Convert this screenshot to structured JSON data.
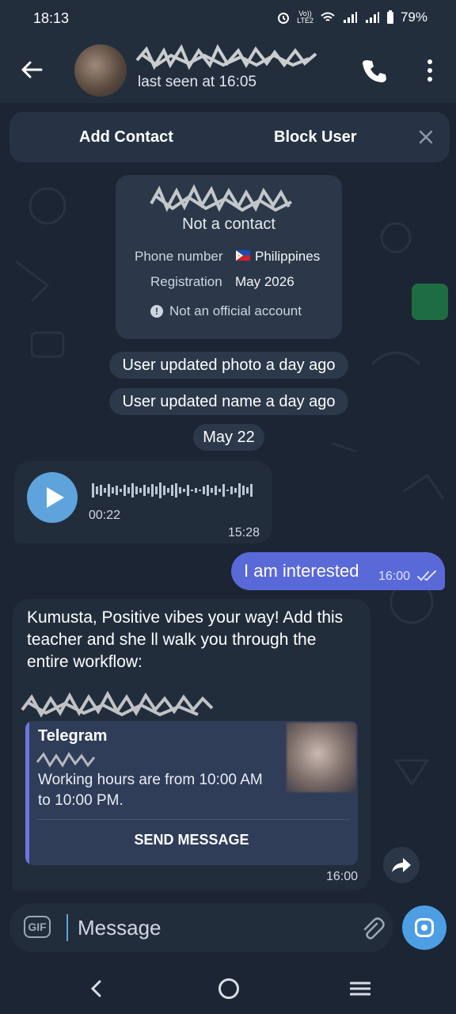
{
  "status_bar": {
    "time": "18:13",
    "lte_top": "Vo))",
    "lte_bottom": "LTE2",
    "battery": "79%"
  },
  "header": {
    "status": "last seen at 16:05",
    "icons": [
      "back-arrow-icon",
      "phone-icon",
      "more-vertical-icon"
    ]
  },
  "action_bar": {
    "add_contact": "Add Contact",
    "block_user": "Block User"
  },
  "info_card": {
    "not_contact": "Not a contact",
    "phone_label": "Phone number",
    "phone_value": "Philippines",
    "registration_label": "Registration",
    "registration_value": "May 2026",
    "official_note": "Not an official account"
  },
  "service": {
    "photo_updated": "User updated photo a day ago",
    "name_updated": "User updated name a day ago",
    "date": "May 22"
  },
  "voice_message": {
    "duration": "00:22",
    "time": "15:28"
  },
  "outgoing": {
    "text": "I am interested",
    "time": "16:00"
  },
  "incoming": {
    "text": "Kumusta, Positive vibes your way! Add this teacher and she ll walk you through the entire workflow:",
    "preview_title": "Telegram",
    "preview_text": "Working hours are from 10:00 AM to 10:00 PM.",
    "action": "SEND MESSAGE",
    "time": "16:00"
  },
  "composer": {
    "gif_label": "GIF",
    "placeholder": "Message"
  },
  "colors": {
    "background": "#1b2533",
    "bar": "#222e3c",
    "outgoing_bubble": "#5a69d8",
    "accent": "#5ea3db"
  }
}
